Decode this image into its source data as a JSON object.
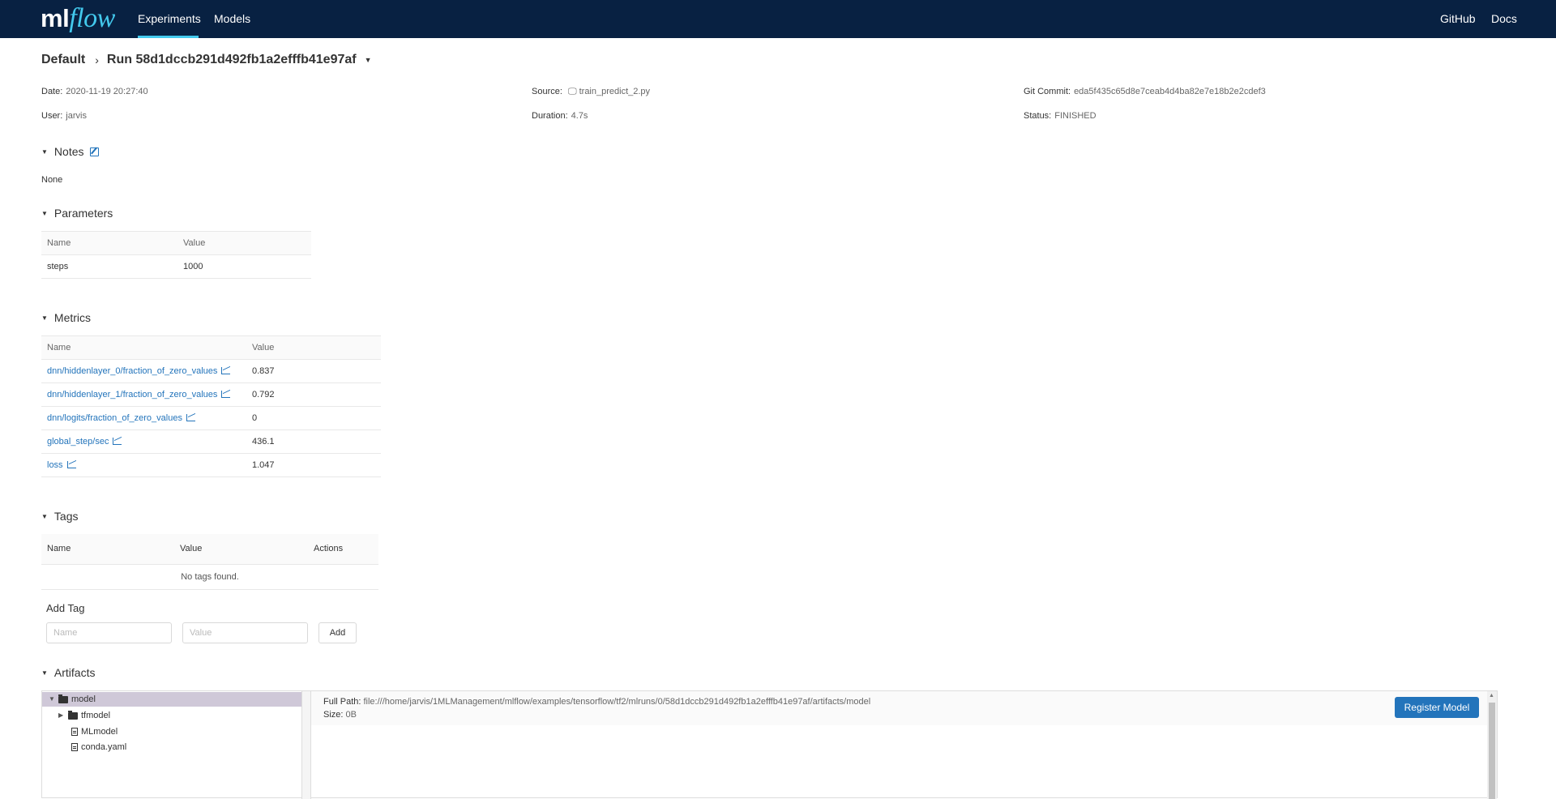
{
  "header": {
    "logo_ml": "ml",
    "logo_flow": "flow",
    "nav": [
      "Experiments",
      "Models"
    ],
    "nav_right": [
      "GitHub",
      "Docs"
    ]
  },
  "breadcrumb": {
    "experiment": "Default",
    "separator": "›",
    "run": "Run 58d1dccb291d492fb1a2efffb41e97af"
  },
  "overview": {
    "date_label": "Date:",
    "date": "2020-11-19 20:27:40",
    "user_label": "User:",
    "user": "jarvis",
    "source_label": "Source:",
    "source": "train_predict_2.py",
    "duration_label": "Duration:",
    "duration": "4.7s",
    "git_label": "Git Commit:",
    "git": "eda5f435c65d8e7ceab4d4ba82e7e18b2e2cdef3",
    "status_label": "Status:",
    "status": "FINISHED"
  },
  "notes": {
    "title": "Notes",
    "content": "None"
  },
  "parameters": {
    "title": "Parameters",
    "headers": [
      "Name",
      "Value"
    ],
    "rows": [
      {
        "name": "steps",
        "value": "1000"
      }
    ]
  },
  "metrics": {
    "title": "Metrics",
    "headers": [
      "Name",
      "Value"
    ],
    "rows": [
      {
        "name": "dnn/hiddenlayer_0/fraction_of_zero_values",
        "value": "0.837"
      },
      {
        "name": "dnn/hiddenlayer_1/fraction_of_zero_values",
        "value": "0.792"
      },
      {
        "name": "dnn/logits/fraction_of_zero_values",
        "value": "0"
      },
      {
        "name": "global_step/sec",
        "value": "436.1"
      },
      {
        "name": "loss",
        "value": "1.047"
      }
    ]
  },
  "tags": {
    "title": "Tags",
    "headers": [
      "Name",
      "Value",
      "Actions"
    ],
    "empty": "No tags found.",
    "add_title": "Add Tag",
    "name_placeholder": "Name",
    "value_placeholder": "Value",
    "add_button": "Add"
  },
  "artifacts": {
    "title": "Artifacts",
    "tree": [
      {
        "name": "model",
        "type": "folder",
        "expanded": true,
        "selected": true
      },
      {
        "name": "tfmodel",
        "type": "folder",
        "expanded": false
      },
      {
        "name": "MLmodel",
        "type": "file"
      },
      {
        "name": "conda.yaml",
        "type": "file"
      }
    ],
    "full_path_label": "Full Path:",
    "full_path": "file:///home/jarvis/1MLManagement/mlflow/examples/tensorflow/tf2/mlruns/0/58d1dccb291d492fb1a2efffb41e97af/artifacts/model",
    "size_label": "Size:",
    "size": "0B",
    "register_button": "Register Model"
  }
}
